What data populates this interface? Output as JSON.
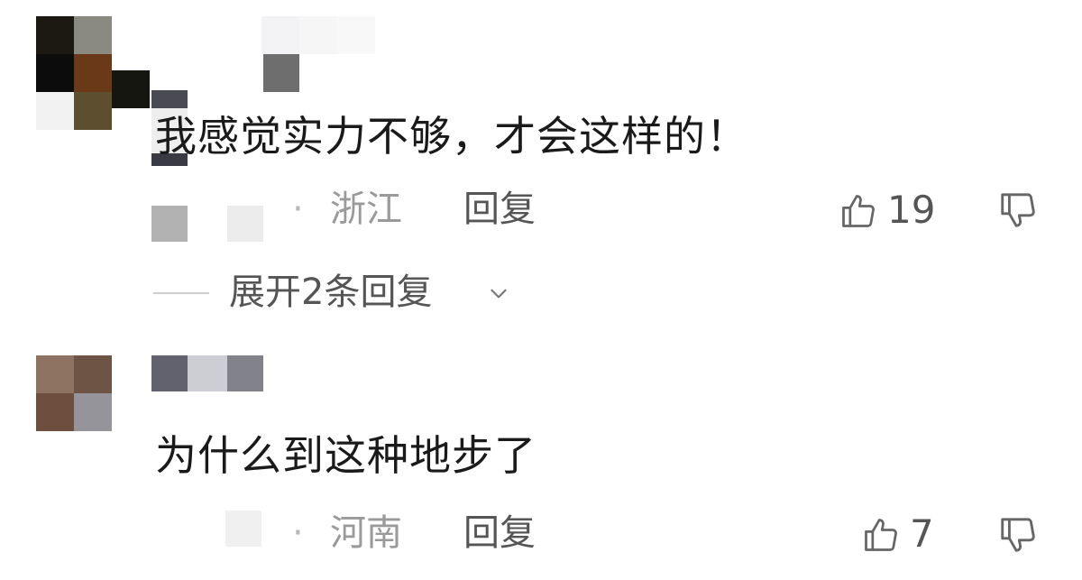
{
  "comments": [
    {
      "text": "我感觉实力不够，才会这样的！",
      "dot": "·",
      "region": "浙江",
      "reply_label": "回复",
      "likes": "19"
    },
    {
      "text": "为什么到这种地步了",
      "dot": "·",
      "region": "河南",
      "reply_label": "回复",
      "likes": "7"
    }
  ],
  "expand_replies_label": "展开2条回复",
  "icons": {
    "like": "thumbs-up-icon",
    "dislike": "thumbs-down-icon",
    "expand": "chevron-down-icon"
  }
}
